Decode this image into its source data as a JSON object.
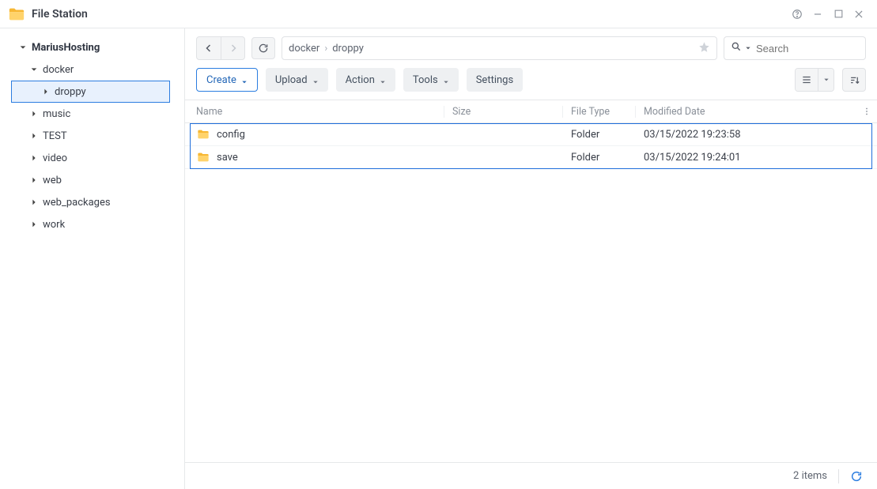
{
  "app": {
    "title": "File Station"
  },
  "sidebar": {
    "root": "MariusHosting",
    "items": [
      {
        "label": "docker",
        "expanded": true,
        "children": [
          {
            "label": "droppy",
            "selected": true
          }
        ]
      },
      {
        "label": "music"
      },
      {
        "label": "TEST"
      },
      {
        "label": "video"
      },
      {
        "label": "web"
      },
      {
        "label": "web_packages"
      },
      {
        "label": "work"
      }
    ]
  },
  "breadcrumb": [
    "docker",
    "droppy"
  ],
  "search": {
    "placeholder": "Search"
  },
  "toolbar": {
    "create": "Create",
    "upload": "Upload",
    "action": "Action",
    "tools": "Tools",
    "settings": "Settings"
  },
  "columns": {
    "name": "Name",
    "size": "Size",
    "type": "File Type",
    "date": "Modified Date"
  },
  "rows": [
    {
      "name": "config",
      "size": "",
      "type": "Folder",
      "date": "03/15/2022 19:23:58"
    },
    {
      "name": "save",
      "size": "",
      "type": "Folder",
      "date": "03/15/2022 19:24:01"
    }
  ],
  "status": {
    "count": "2 items"
  }
}
